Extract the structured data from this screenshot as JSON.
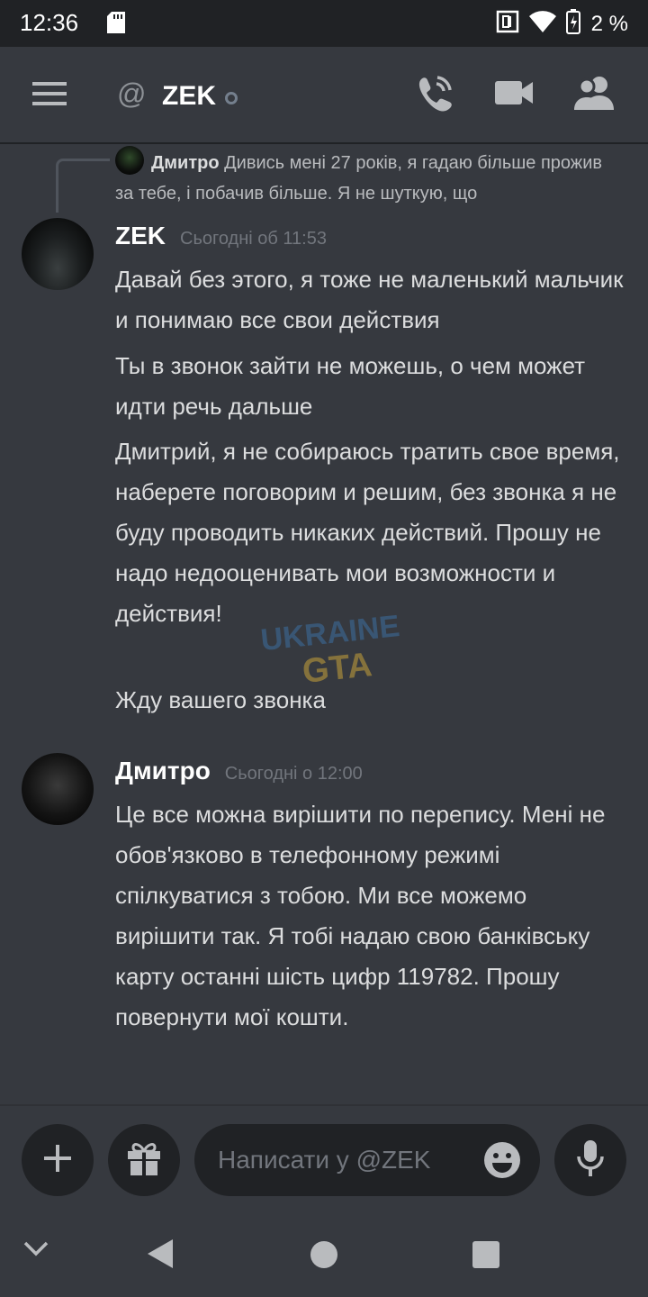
{
  "status_bar": {
    "time": "12:36",
    "battery_percent": "2 %"
  },
  "header": {
    "channel_prefix": "@",
    "title": "ZEK"
  },
  "reply": {
    "author": "Дмитро",
    "text": "Дивись мені 27 років, я гадаю більше прожив за тебе, і побачив більше. Я не шуткую, що"
  },
  "messages": [
    {
      "author": "ZEK",
      "timestamp": "Сьогодні об 11:53",
      "paragraphs": [
        "Давай без этого,  я тоже не маленький мальчик и понимаю все свои действия",
        "Ты в звонок зайти не можешь, о чем может идти речь дальше",
        "Дмитрий, я не собираюсь тратить  свое время, наберете поговорим и решим, без звонка я не буду проводить никаких действий. Прошу не надо недооценивать мои возможности и действия!",
        "Жду вашего звонка"
      ]
    },
    {
      "author": "Дмитро",
      "timestamp": "Сьогодні о 12:00",
      "paragraphs": [
        "Це все можна вирішити по перепису. Мені не обов'язково в телефонному режимі спілкуватися з тобою. Ми все можемо вирішити так. Я тобі надаю свою банківську карту останні шість цифр 119782. Прошу повернути мої кошти."
      ]
    }
  ],
  "composer": {
    "placeholder": "Написати у @ZEK"
  },
  "watermark": "UKRAINE GTA",
  "colors": {
    "background": "#36393f",
    "header_bar": "#202225",
    "text": "#dcddde",
    "muted": "#72767d"
  },
  "icons": {
    "menu": "hamburger-menu-icon",
    "call": "phone-call-icon",
    "video": "video-camera-icon",
    "members": "members-icon",
    "add": "plus-icon",
    "gift": "gift-icon",
    "emoji": "emoji-icon",
    "mic": "microphone-icon"
  }
}
